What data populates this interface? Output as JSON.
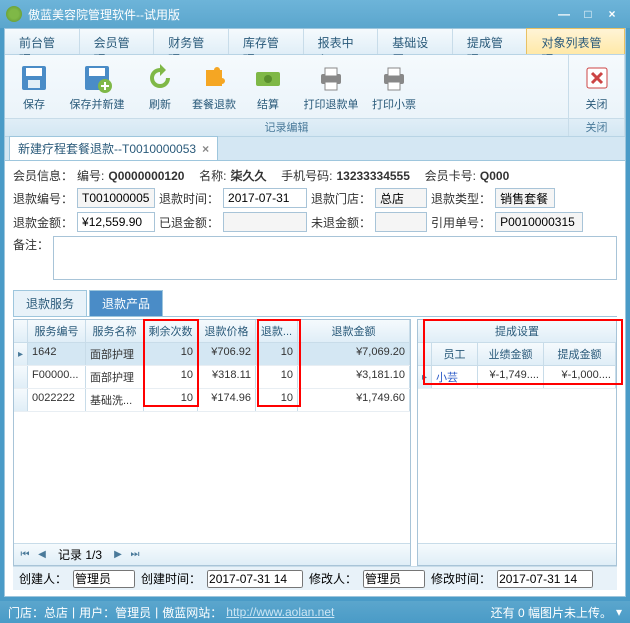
{
  "window": {
    "title": "傲蓝美容院管理软件--试用版"
  },
  "menu": [
    "前台管理",
    "会员管理",
    "财务管理",
    "库存管理",
    "报表中心",
    "基础设置",
    "提成管理",
    "对象列表管理"
  ],
  "menu_active": 7,
  "ribbon": {
    "group1_label": "记录编辑",
    "group2_label": "关闭",
    "buttons": {
      "save": "保存",
      "saveNew": "保存并新建",
      "refresh": "刷新",
      "pkgRefund": "套餐退款",
      "settle": "结算",
      "printRefund": "打印退款单",
      "printTicket": "打印小票",
      "close": "关闭"
    }
  },
  "tab": {
    "title": "新建疗程套餐退款--T0010000053"
  },
  "member": {
    "info_label": "会员信息：",
    "id_label": "编号:",
    "id": "Q0000000120",
    "name_label": "名称:",
    "name": "柒久久",
    "phone_label": "手机号码:",
    "phone": "13233334555",
    "card_label": "会员卡号:",
    "card": "Q000"
  },
  "refund": {
    "no_label": "退款编号：",
    "no": "T001000005",
    "time_label": "退款时间：",
    "time": "2017-07-31",
    "store_label": "退款门店：",
    "store": "总店",
    "type_label": "退款类型：",
    "type": "销售套餐",
    "amount_label": "退款金额：",
    "amount": "¥12,559.90",
    "paid_label": "已退金额：",
    "paid": "",
    "unpaid_label": "未退金额：",
    "unpaid": "",
    "ref_label": "引用单号：",
    "ref": "P0010000315",
    "remark_label": "备注："
  },
  "subtabs": [
    "退款服务",
    "退款产品"
  ],
  "grid": {
    "headers": [
      "服务编号",
      "服务名称",
      "剩余次数",
      "退款价格",
      "退款...",
      "退款金额"
    ],
    "rows": [
      {
        "ind": "▸",
        "c0": "1642",
        "c1": "面部护理",
        "c2": "10",
        "c3": "¥706.92",
        "c4": "10",
        "c5": "¥7,069.20",
        "sel": true
      },
      {
        "ind": "",
        "c0": "F00000...",
        "c1": "面部护理",
        "c2": "10",
        "c3": "¥318.11",
        "c4": "10",
        "c5": "¥3,181.10"
      },
      {
        "ind": "",
        "c0": "0022222",
        "c1": "基础洗...",
        "c2": "10",
        "c3": "¥174.96",
        "c4": "10",
        "c5": "¥1,749.60"
      }
    ],
    "pager": "记录 1/3"
  },
  "commission": {
    "title": "提成设置",
    "headers": [
      "员工",
      "业绩金额",
      "提成金额"
    ],
    "row": {
      "emp": "小芸",
      "perf": "¥-1,749....",
      "comm": "¥-1,000...."
    }
  },
  "footer": {
    "creator_label": "创建人：",
    "creator": "管理员",
    "ctime_label": "创建时间：",
    "ctime": "2017-07-31 14",
    "modifier_label": "修改人：",
    "modifier": "管理员",
    "mtime_label": "修改时间：",
    "mtime": "2017-07-31 14"
  },
  "status": {
    "store": "门店：总店",
    "sep": "|",
    "user": "用户：管理员",
    "sitelabel": "傲蓝网站：",
    "site": "http://www.aolan.net",
    "right": "还有 0 幅图片未上传。"
  }
}
